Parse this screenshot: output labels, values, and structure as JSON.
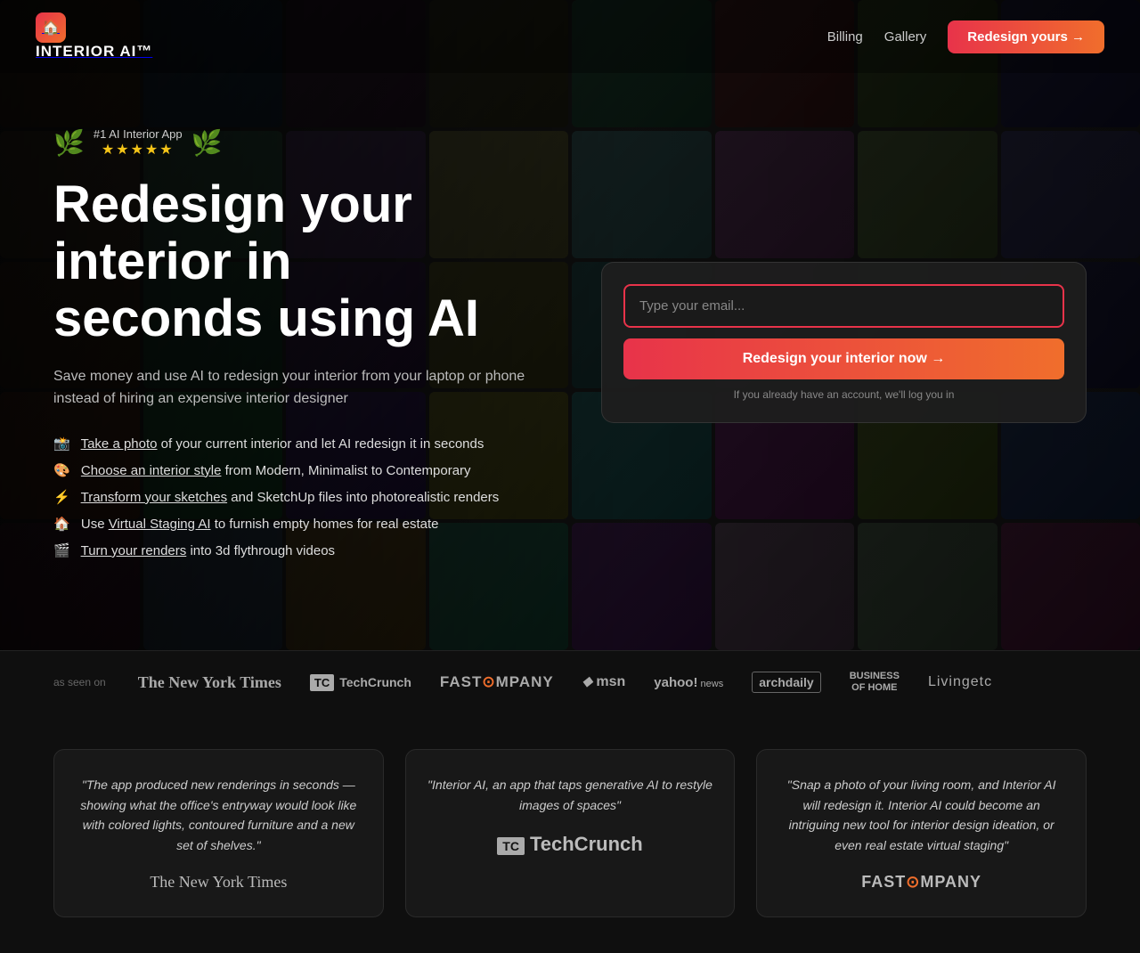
{
  "nav": {
    "logo_text": "INTERIOR AI™",
    "logo_icon": "🏠",
    "links": [
      {
        "label": "Billing",
        "href": "#"
      },
      {
        "label": "Gallery",
        "href": "#"
      }
    ],
    "cta_label": "Redesign yours →"
  },
  "hero": {
    "award": {
      "title": "#1 AI Interior App",
      "stars": "★★★★★"
    },
    "heading_line1": "Redesign your interior in",
    "heading_line2": "seconds using AI",
    "subtext": "Save money and use AI to redesign your interior from your laptop or phone instead of hiring an expensive interior designer",
    "features": [
      {
        "emoji": "📸",
        "prefix": "",
        "link_text": "Take a photo",
        "suffix": " of your current interior and let AI redesign it in seconds"
      },
      {
        "emoji": "🎨",
        "prefix": "",
        "link_text": "Choose an interior style",
        "suffix": " from Modern, Minimalist to Contemporary"
      },
      {
        "emoji": "⚡",
        "prefix": "",
        "link_text": "Transform your sketches",
        "suffix": " and SketchUp files into photorealistic renders"
      },
      {
        "emoji": "🏠",
        "prefix": "Use ",
        "link_text": "Virtual Staging AI",
        "suffix": " to furnish empty homes for real estate"
      },
      {
        "emoji": "🎬",
        "prefix": "",
        "link_text": "Turn your renders",
        "suffix": " into 3d flythrough videos"
      }
    ]
  },
  "email_form": {
    "placeholder": "Type your email...",
    "submit_label": "Redesign your interior now →",
    "note": "If you already have an account, we'll log you in"
  },
  "press": {
    "label": "as seen on",
    "logos": [
      {
        "text": "The New York Times",
        "style": "serif"
      },
      {
        "text": "TechCrunch",
        "style": "tc"
      },
      {
        "text": "FAST COMPANY",
        "style": "bold"
      },
      {
        "text": "msn",
        "style": "italic"
      },
      {
        "text": "yahoo! news",
        "style": "bold"
      },
      {
        "text": "archdaily",
        "style": "normal"
      },
      {
        "text": "BUSINESS OF HOME",
        "style": "bold-small"
      },
      {
        "text": "Livingetc",
        "style": "normal"
      }
    ]
  },
  "testimonials": [
    {
      "text": "\"The app produced new renderings in seconds — showing what the office's entryway would look like with colored lights, contoured furniture and a new set of shelves.\"",
      "logo": "The New York Times",
      "logo_style": "serif"
    },
    {
      "text": "\"Interior AI, an app that taps generative AI to restyle images of spaces\"",
      "logo": "TechCrunch",
      "logo_style": "tech"
    },
    {
      "text": "\"Snap a photo of your living room, and Interior AI will redesign it. Interior AI could become an intriguing new tool for interior design ideation, or even real estate virtual staging\"",
      "logo": "FAST COMPANY",
      "logo_style": "bold"
    }
  ]
}
